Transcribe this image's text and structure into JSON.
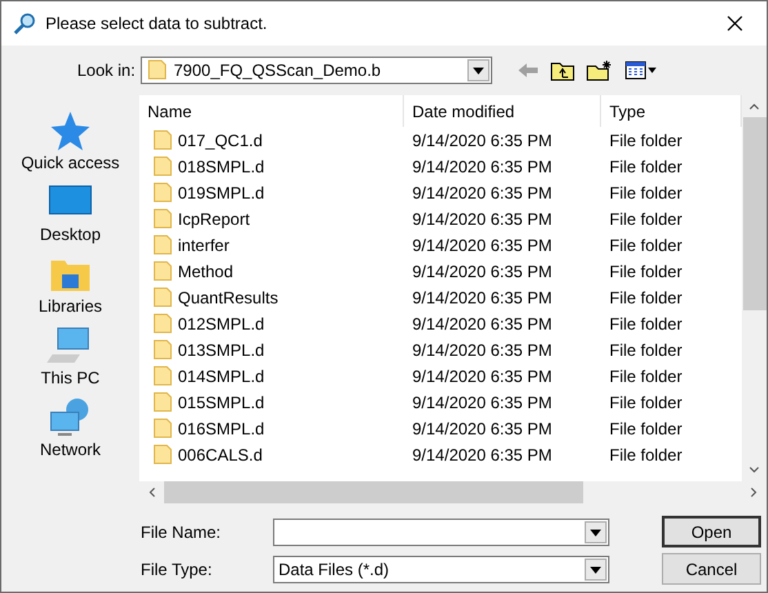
{
  "window": {
    "title": "Please select data to subtract."
  },
  "look_in": {
    "label": "Look in:",
    "value": "7900_FQ_QSScan_Demo.b"
  },
  "places": [
    {
      "kind": "star",
      "label": "Quick access",
      "selected": false
    },
    {
      "kind": "desktop",
      "label": "Desktop",
      "selected": false
    },
    {
      "kind": "libraries",
      "label": "Libraries",
      "selected": false
    },
    {
      "kind": "pc",
      "label": "This PC",
      "selected": false
    },
    {
      "kind": "network",
      "label": "Network",
      "selected": false
    }
  ],
  "table": {
    "columns": [
      "Name",
      "Date modified",
      "Type"
    ],
    "rows": [
      {
        "name": "017_QC1.d",
        "date": "9/14/2020 6:35 PM",
        "type": "File folder"
      },
      {
        "name": "018SMPL.d",
        "date": "9/14/2020 6:35 PM",
        "type": "File folder"
      },
      {
        "name": "019SMPL.d",
        "date": "9/14/2020 6:35 PM",
        "type": "File folder"
      },
      {
        "name": "IcpReport",
        "date": "9/14/2020 6:35 PM",
        "type": "File folder"
      },
      {
        "name": "interfer",
        "date": "9/14/2020 6:35 PM",
        "type": "File folder"
      },
      {
        "name": "Method",
        "date": "9/14/2020 6:35 PM",
        "type": "File folder"
      },
      {
        "name": "QuantResults",
        "date": "9/14/2020 6:35 PM",
        "type": "File folder"
      },
      {
        "name": "012SMPL.d",
        "date": "9/14/2020 6:35 PM",
        "type": "File folder"
      },
      {
        "name": "013SMPL.d",
        "date": "9/14/2020 6:35 PM",
        "type": "File folder"
      },
      {
        "name": "014SMPL.d",
        "date": "9/14/2020 6:35 PM",
        "type": "File folder"
      },
      {
        "name": "015SMPL.d",
        "date": "9/14/2020 6:35 PM",
        "type": "File folder"
      },
      {
        "name": "016SMPL.d",
        "date": "9/14/2020 6:35 PM",
        "type": "File folder"
      },
      {
        "name": "006CALS.d",
        "date": "9/14/2020 6:35 PM",
        "type": "File folder"
      }
    ]
  },
  "file_name": {
    "label": "File Name:"
  },
  "file_type": {
    "label": "File Type:",
    "value": "Data Files (*.d)"
  },
  "buttons": [
    "Open",
    "Cancel"
  ]
}
